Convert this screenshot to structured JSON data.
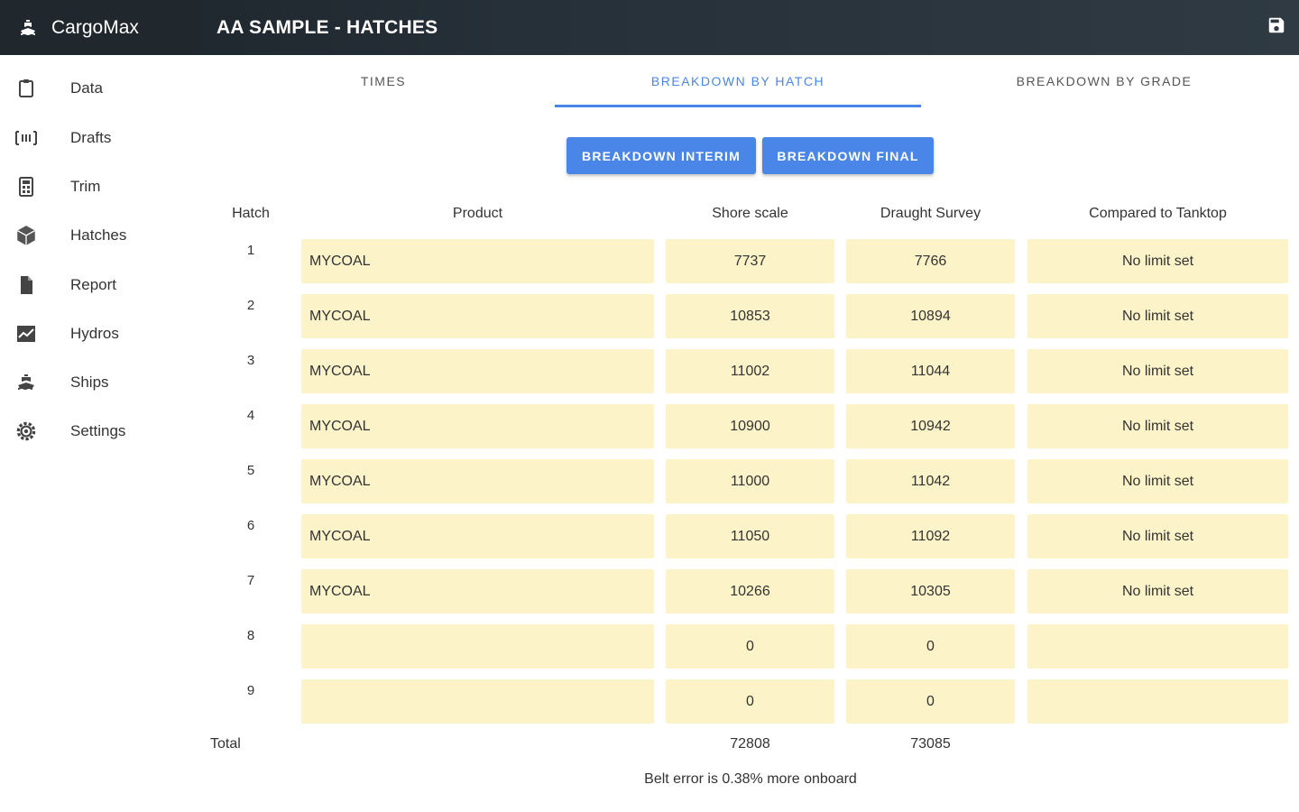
{
  "app": {
    "name": "CargoMax",
    "page_title": "AA SAMPLE - HATCHES",
    "save_icon": "save-icon",
    "brand_icon": "ship-icon"
  },
  "sidebar": {
    "items": [
      {
        "label": "Data",
        "icon": "clipboard-icon"
      },
      {
        "label": "Drafts",
        "icon": "drafts-icon"
      },
      {
        "label": "Trim",
        "icon": "calculator-icon"
      },
      {
        "label": "Hatches",
        "icon": "cube-icon"
      },
      {
        "label": "Report",
        "icon": "document-icon"
      },
      {
        "label": "Hydros",
        "icon": "chart-icon"
      },
      {
        "label": "Ships",
        "icon": "ship-icon"
      },
      {
        "label": "Settings",
        "icon": "gear-icon"
      }
    ]
  },
  "tabs": [
    {
      "label": "TIMES",
      "active": false
    },
    {
      "label": "BREAKDOWN BY HATCH",
      "active": true
    },
    {
      "label": "BREAKDOWN BY GRADE",
      "active": false
    }
  ],
  "buttons": {
    "interim": "BREAKDOWN INTERIM",
    "final": "BREAKDOWN FINAL"
  },
  "table": {
    "headers": {
      "hatch": "Hatch",
      "product": "Product",
      "shore": "Shore scale",
      "draught": "Draught Survey",
      "compared": "Compared to Tanktop"
    },
    "rows": [
      {
        "hatch": "1",
        "product": "MYCOAL",
        "shore": "7737",
        "draught": "7766",
        "compared": "No limit set"
      },
      {
        "hatch": "2",
        "product": "MYCOAL",
        "shore": "10853",
        "draught": "10894",
        "compared": "No limit set"
      },
      {
        "hatch": "3",
        "product": "MYCOAL",
        "shore": "11002",
        "draught": "11044",
        "compared": "No limit set"
      },
      {
        "hatch": "4",
        "product": "MYCOAL",
        "shore": "10900",
        "draught": "10942",
        "compared": "No limit set"
      },
      {
        "hatch": "5",
        "product": "MYCOAL",
        "shore": "11000",
        "draught": "11042",
        "compared": "No limit set"
      },
      {
        "hatch": "6",
        "product": "MYCOAL",
        "shore": "11050",
        "draught": "11092",
        "compared": "No limit set"
      },
      {
        "hatch": "7",
        "product": "MYCOAL",
        "shore": "10266",
        "draught": "10305",
        "compared": "No limit set"
      },
      {
        "hatch": "8",
        "product": "",
        "shore": "0",
        "draught": "0",
        "compared": ""
      },
      {
        "hatch": "9",
        "product": "",
        "shore": "0",
        "draught": "0",
        "compared": ""
      }
    ],
    "total_label": "Total",
    "total_shore": "72808",
    "total_draught": "73085",
    "belt_error": "Belt error is 0.38% more onboard"
  },
  "colors": {
    "accent": "#4a86e8",
    "cell_bg": "#fdf3c8",
    "topbar": "#263038"
  }
}
